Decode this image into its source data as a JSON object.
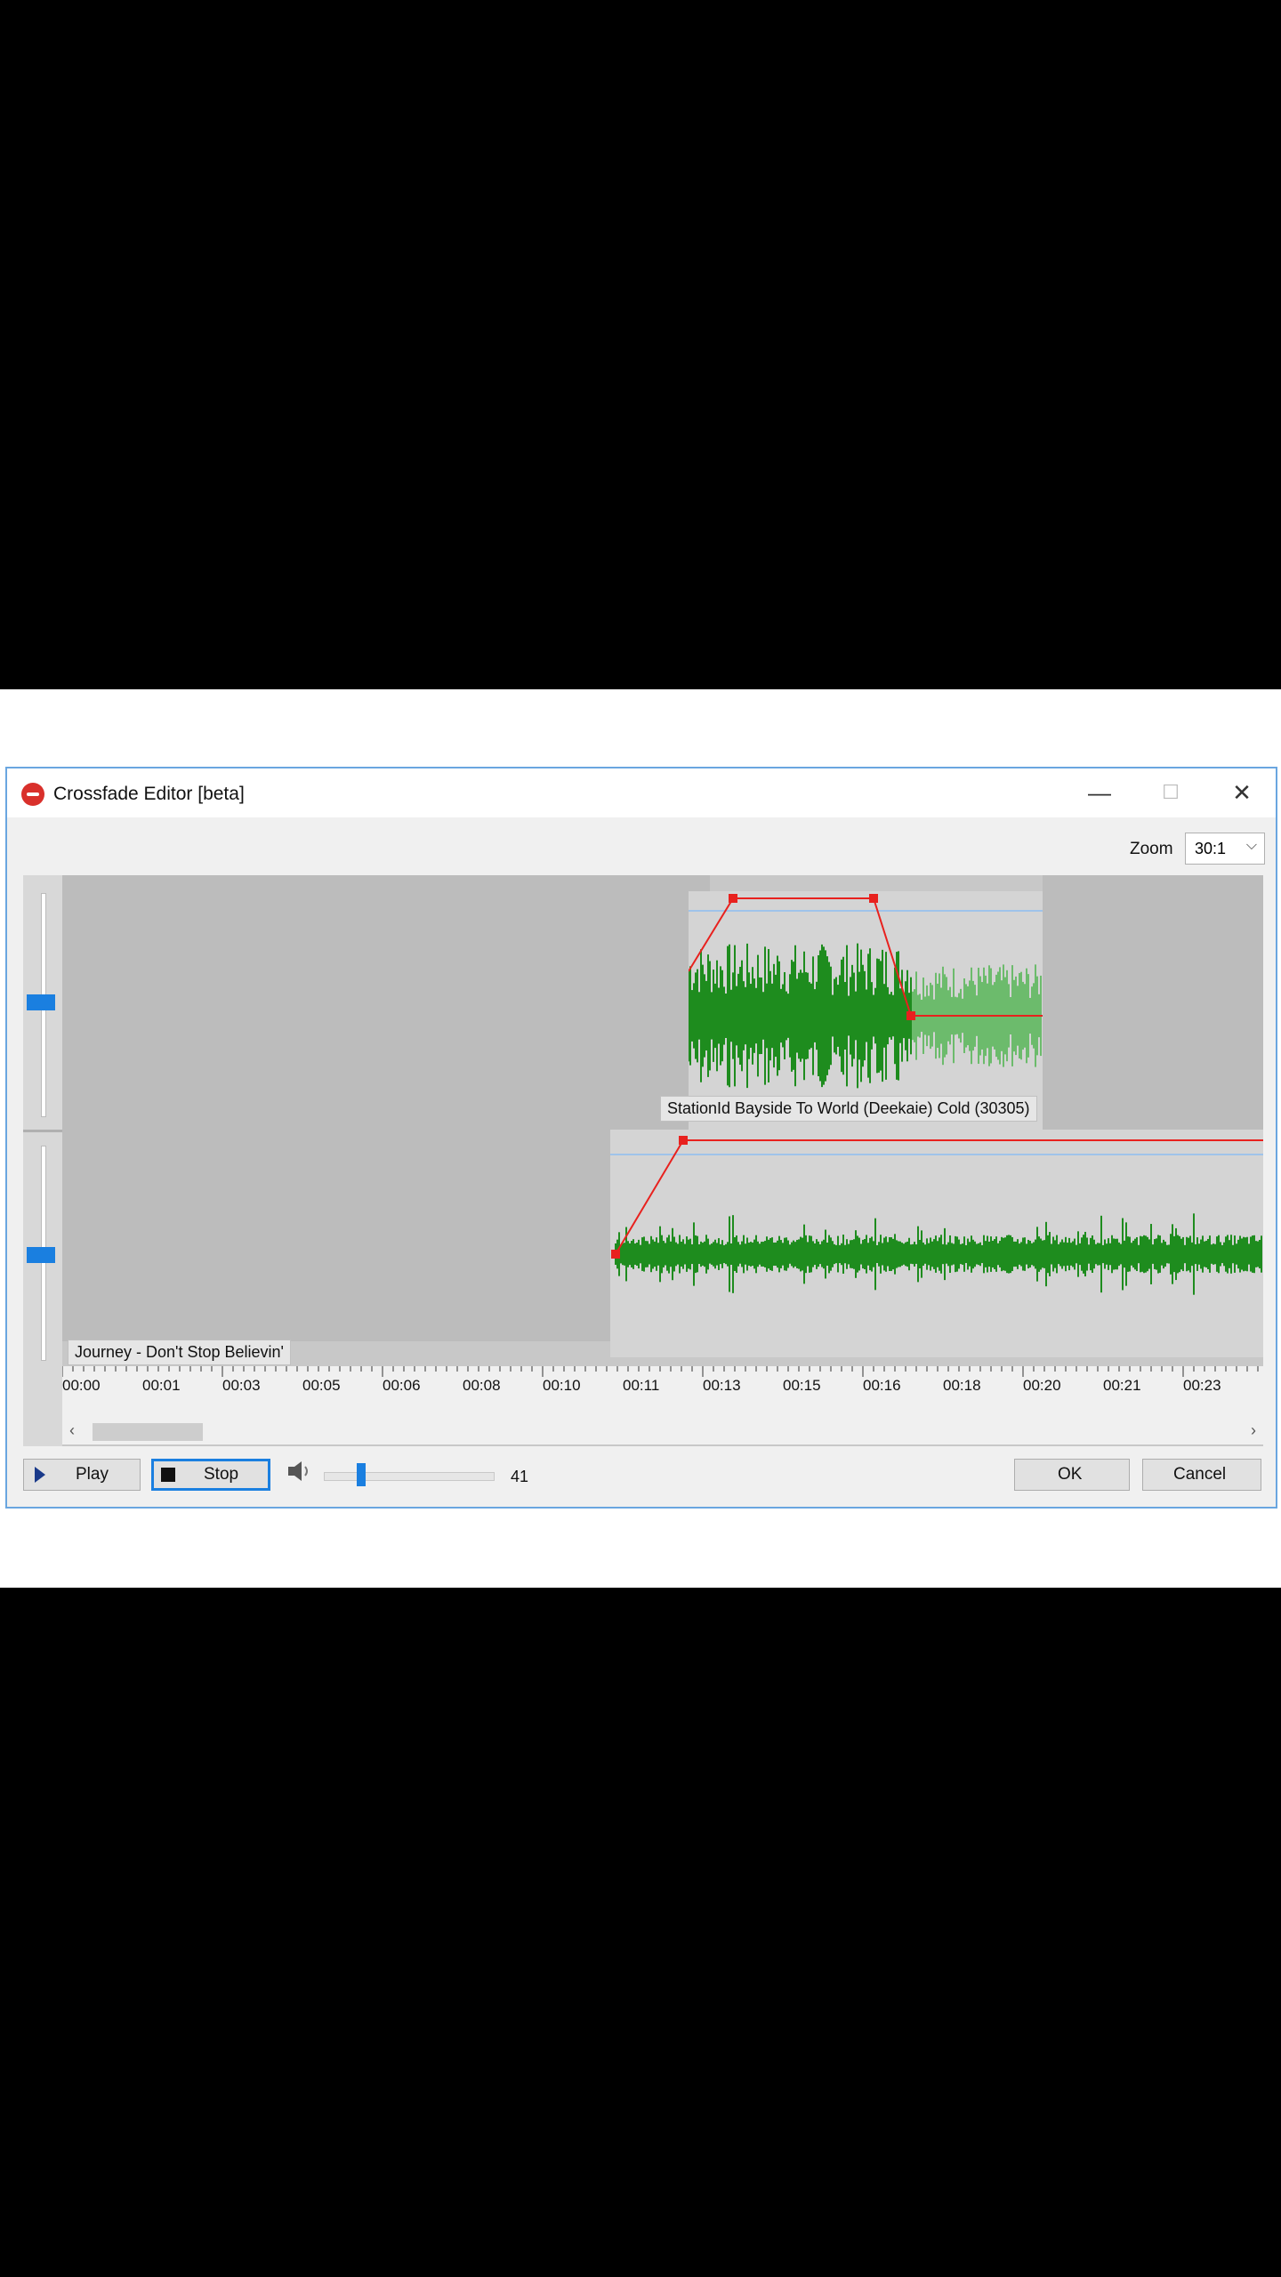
{
  "window": {
    "title": "Crossfade Editor [beta]",
    "minimize": "—",
    "maximize": "☐",
    "close": "✕"
  },
  "zoom": {
    "label": "Zoom",
    "value": "30:1"
  },
  "tracks": {
    "upper": {
      "label": "StationId Bayside To World (Deekaie) Cold (30305)",
      "wave_color": "#1e8c1e",
      "faded_wave_color": "#6cbb6c"
    },
    "lower": {
      "label": "Journey - Don't Stop Believin'",
      "wave_color": "#1e8c1e"
    }
  },
  "envelope_color": "#e8211e",
  "timeline": {
    "ticks": [
      "00:00",
      "00:01",
      "00:03",
      "00:05",
      "00:06",
      "00:08",
      "00:10",
      "00:11",
      "00:13",
      "00:15",
      "00:16",
      "00:18",
      "00:20",
      "00:21",
      "00:23"
    ]
  },
  "controls": {
    "play_label": "Play",
    "stop_label": "Stop",
    "volume_value": "41",
    "volume_fraction": 0.22,
    "ok_label": "OK",
    "cancel_label": "Cancel"
  }
}
